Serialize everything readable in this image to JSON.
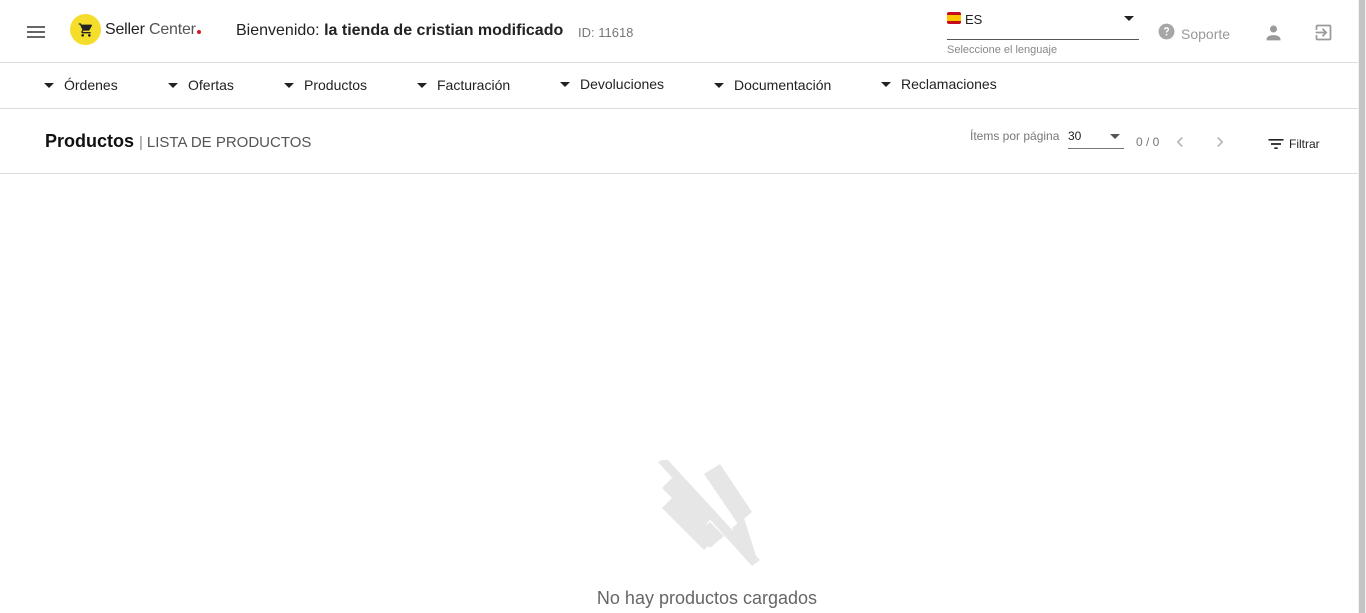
{
  "header": {
    "brand": {
      "name": "Seller",
      "name_light": "Center"
    },
    "welcome_prefix": "Bienvenido:",
    "store_name": "la tienda de cristian modificado",
    "store_id": "ID: 11618",
    "language": {
      "code": "ES",
      "hint": "Seleccione el lenguaje"
    },
    "support_label": "Soporte"
  },
  "nav": {
    "items": [
      {
        "label": "Órdenes"
      },
      {
        "label": "Ofertas"
      },
      {
        "label": "Productos"
      },
      {
        "label": "Facturación"
      },
      {
        "label": "Devoluciones"
      },
      {
        "label": "Documentación"
      },
      {
        "label": "Reclamaciones"
      }
    ]
  },
  "page": {
    "title": "Productos",
    "subtitle": "LISTA DE PRODUCTOS",
    "items_per_page_label": "Ítems por página",
    "items_per_page_value": "30",
    "range": "0 / 0",
    "filter_label": "Filtrar"
  },
  "empty_state": {
    "message": "No hay productos cargados"
  },
  "colors": {
    "brand_yellow": "#f5dd2b",
    "brand_red": "#d71920",
    "divider": "#dcdcdc",
    "icon_gray": "#9a9a9a"
  }
}
